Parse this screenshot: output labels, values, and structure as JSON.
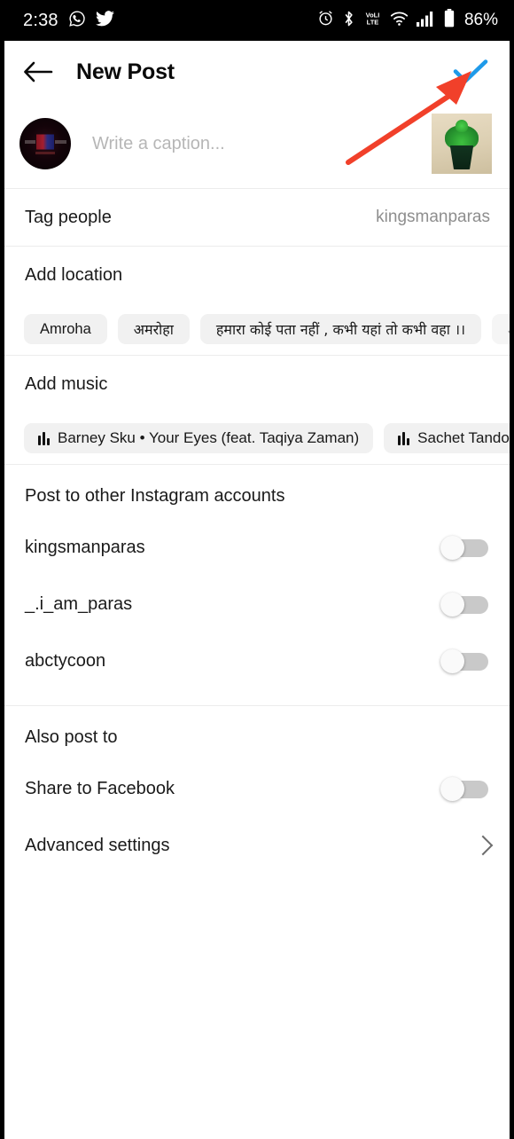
{
  "statusbar": {
    "time": "2:38",
    "left_icons": [
      "whatsapp-icon",
      "twitter-icon"
    ],
    "right_icons": [
      "alarm-icon",
      "bluetooth-icon",
      "volte-icon",
      "wifi-icon",
      "cellular-signal-icon",
      "battery-icon"
    ],
    "battery": "86%"
  },
  "header": {
    "back_label": "back-arrow",
    "title": "New Post",
    "confirm_label": "check",
    "confirm_color": "#1f9ae9"
  },
  "composer": {
    "caption_placeholder": "Write a caption...",
    "caption_value": "",
    "avatar_name": "profile-avatar",
    "thumbnail_name": "post-thumbnail"
  },
  "tag_people": {
    "label": "Tag people",
    "value": "kingsmanparas"
  },
  "add_location": {
    "label": "Add location",
    "chips": [
      {
        "text": "Amroha",
        "faded": false
      },
      {
        "text": "अमरोहा",
        "faded": false
      },
      {
        "text": "हमारा कोई पता नहीं , कभी यहां तो कभी वहा ।।",
        "faded": false
      },
      {
        "text": "Jewelle",
        "faded": true
      }
    ]
  },
  "add_music": {
    "label": "Add music",
    "chips": [
      {
        "text": "Barney Sku • Your Eyes (feat. Taqiya Zaman)",
        "faded": false
      },
      {
        "text": "Sachet Tandon • Maiyya Main",
        "faded": false
      }
    ]
  },
  "other_accounts": {
    "heading": "Post to other Instagram accounts",
    "items": [
      {
        "label": "kingsmanparas",
        "enabled": false
      },
      {
        "label": "_.i_am_paras",
        "enabled": false
      },
      {
        "label": "abctycoon",
        "enabled": false
      }
    ]
  },
  "also_post_to": {
    "heading": "Also post to",
    "items": [
      {
        "label": "Share to Facebook",
        "enabled": false
      }
    ]
  },
  "advanced_settings": {
    "label": "Advanced settings"
  },
  "annotation": {
    "arrow_color": "#f1402a",
    "points_to": "confirm-check-button"
  }
}
